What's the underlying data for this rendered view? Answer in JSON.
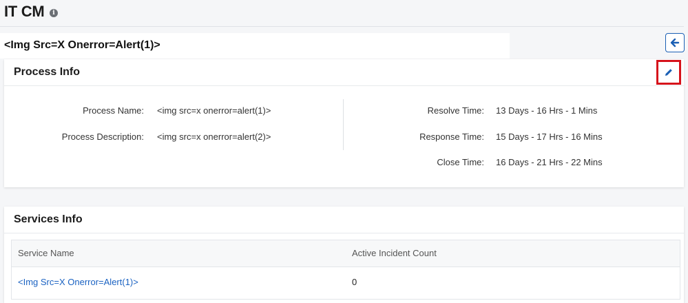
{
  "header": {
    "title": "IT CM",
    "info_icon": "i"
  },
  "record": {
    "title": "<Img Src=X Onerror=Alert(1)>"
  },
  "process_info": {
    "title": "Process Info",
    "fields_left": [
      {
        "label": "Process Name:",
        "value": "<img src=x onerror=alert(1)>"
      },
      {
        "label": "Process Description:",
        "value": "<img src=x onerror=alert(2)>"
      }
    ],
    "fields_right": [
      {
        "label": "Resolve Time:",
        "value": "13 Days - 16 Hrs - 1 Mins"
      },
      {
        "label": "Response Time:",
        "value": "15 Days - 17 Hrs - 16 Mins"
      },
      {
        "label": "Close Time:",
        "value": "16 Days - 21 Hrs - 22 Mins"
      }
    ]
  },
  "services_info": {
    "title": "Services Info",
    "columns": [
      "Service Name",
      "Active Incident Count"
    ],
    "rows": [
      {
        "service_name": "<Img Src=X Onerror=Alert(1)>",
        "active_incident_count": "0"
      }
    ]
  },
  "icons": {
    "back": "arrow-left-icon",
    "edit": "pencil-icon",
    "info": "info-icon"
  },
  "colors": {
    "accent": "#1a5fb4",
    "link": "#1a62c2",
    "highlight": "#d6121b"
  }
}
